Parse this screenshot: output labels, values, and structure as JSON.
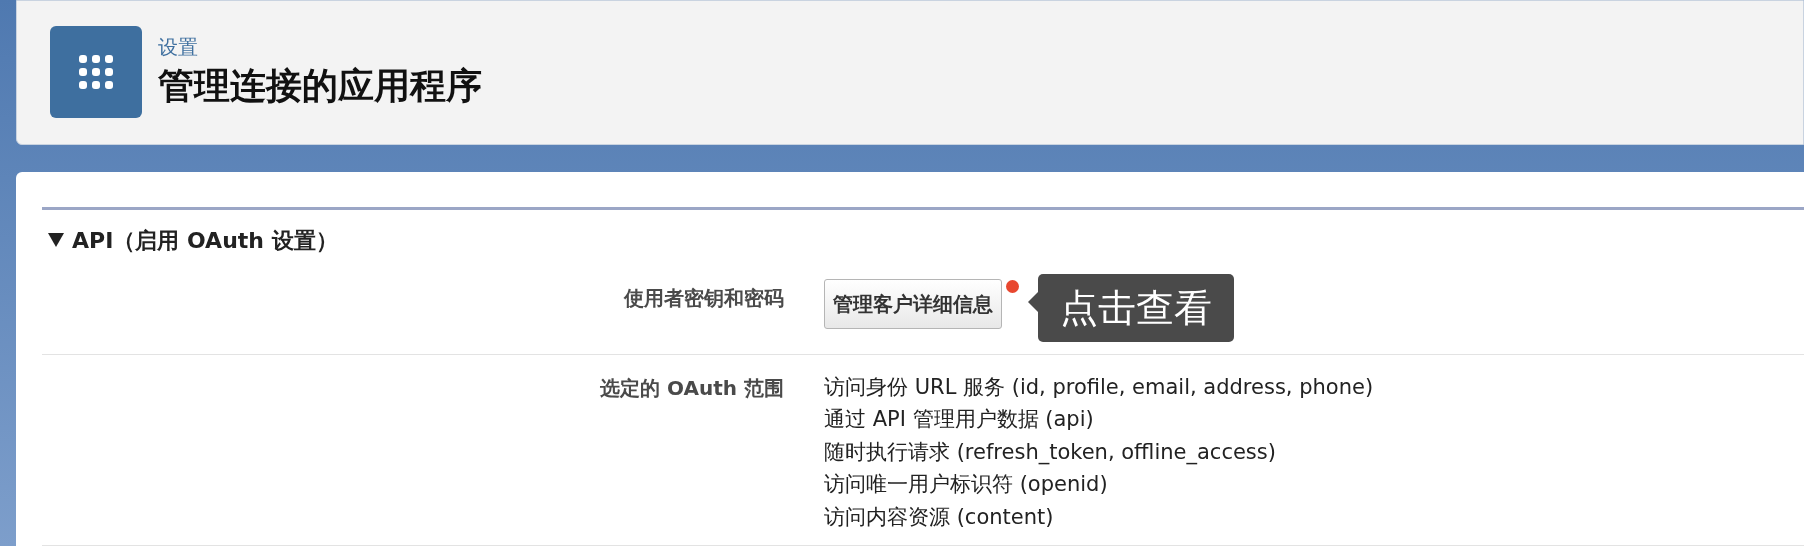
{
  "header": {
    "breadcrumb": "设置",
    "title": "管理连接的应用程序"
  },
  "section": {
    "title": "API（启用 OAuth 设置）",
    "expanded": true,
    "rows": [
      {
        "kind": "button",
        "label": "使用者密钥和密码",
        "button": "管理客户详细信息",
        "tooltip": "点击查看"
      },
      {
        "kind": "list",
        "label": "选定的 OAuth 范围",
        "items": [
          "访问身份 URL 服务 (id, profile, email, address, phone)",
          "通过 API 管理用户数据 (api)",
          "随时执行请求 (refresh_token, offline_access)",
          "访问唯一用户标识符 (openid)",
          "访问内容资源 (content)"
        ]
      }
    ]
  }
}
